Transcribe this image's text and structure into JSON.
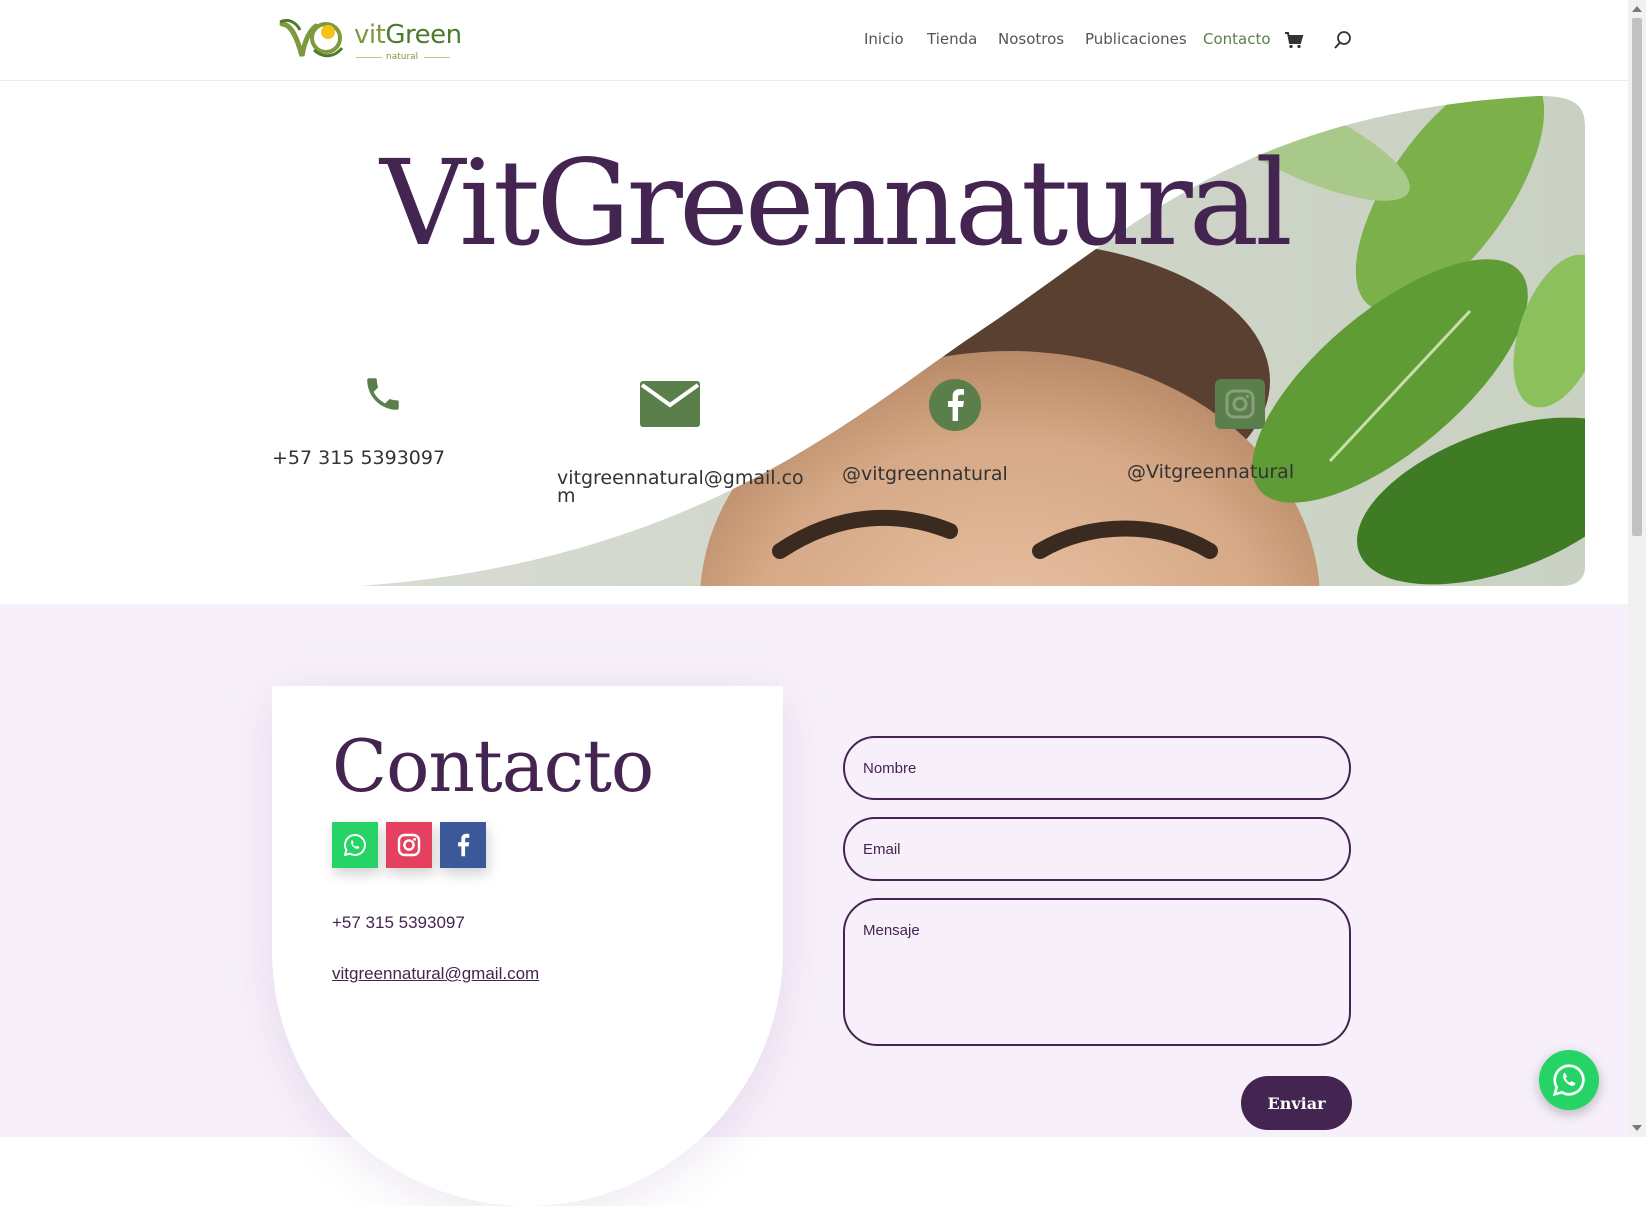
{
  "brand": {
    "logo_main": "vit",
    "logo_green": "Green",
    "logo_sub": "natural"
  },
  "nav": {
    "items": [
      {
        "label": "Inicio"
      },
      {
        "label": "Tienda"
      },
      {
        "label": "Nosotros"
      },
      {
        "label": "Publicaciones"
      },
      {
        "label": "Contacto",
        "active": true
      }
    ],
    "cart_icon": "cart-icon",
    "search_icon": "search-icon"
  },
  "hero": {
    "title": "VitGreennatural",
    "contacts": [
      {
        "icon": "phone-icon",
        "text": "+57 315 5393097"
      },
      {
        "icon": "envelope-icon",
        "text_line1": "vitgreennatural@gmail.co",
        "text_line2": "m"
      },
      {
        "icon": "facebook-icon",
        "text": "@vitgreennatural"
      },
      {
        "icon": "instagram-icon",
        "text": "@Vitgreennatural"
      }
    ]
  },
  "contact_card": {
    "title": "Contacto",
    "social": [
      {
        "icon": "whatsapp-icon",
        "color": "#25d366"
      },
      {
        "icon": "instagram-icon",
        "color": "#e4405f"
      },
      {
        "icon": "facebook-icon",
        "color": "#3b5998"
      }
    ],
    "phone": "+57 315 5393097",
    "email": "vitgreennatural@gmail.com"
  },
  "form": {
    "name_placeholder": "Nombre",
    "email_placeholder": "Email",
    "message_placeholder": "Mensaje",
    "submit_label": "Enviar"
  },
  "colors": {
    "primary": "#442450",
    "icon_green": "#5b7f4a",
    "section_bg": "#f7f0fa"
  }
}
